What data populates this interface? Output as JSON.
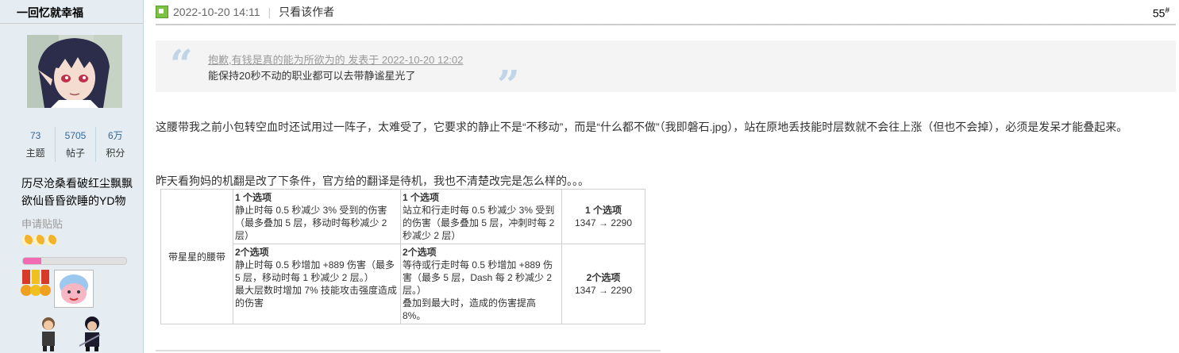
{
  "user": {
    "name": "一回忆就幸福",
    "stats": [
      {
        "value": "73",
        "label": "主题"
      },
      {
        "value": "5705",
        "label": "帖子"
      },
      {
        "value": "6万",
        "label": "积分"
      }
    ],
    "signature": [
      "历尽沧桑看破红尘飘飘",
      "欲仙昏昏欲睡的YD物"
    ],
    "apply_label": "申请贴贴",
    "level_progress": 0.18
  },
  "post": {
    "timestamp": "2022-10-20 14:11",
    "author_only": "只看该作者",
    "floor": "55",
    "floor_mark": "#",
    "quote": {
      "source": "抱歉,有钱是真的能为所欲为的 发表于 2022-10-20 12:02",
      "text": "能保持20秒不动的职业都可以去带静谧星光了"
    },
    "para1": "这腰带我之前小包转空血时还试用过一阵子，太难受了，它要求的静止不是“不移动”，而是“什么都不做”（我即磐石.jpg），站在原地丢技能时层数就不会往上涨（但也不会掉），必须是发呆才能叠起来。",
    "para2": "昨天看狗妈的机翻是改了下条件，官方给的翻译是待机，我也不清楚改完是怎么样的。。。",
    "table": {
      "item_name": "带星星的腰带",
      "row1": {
        "c1_title": "1 个选项",
        "c1_body": "静止时每 0.5 秒减少 3% 受到的伤害（最多叠加 5 层，移动时每秒减少 2 层）",
        "c2_title": "1 个选项",
        "c2_body": "站立和行走时每 0.5 秒减少 3% 受到的伤害（最多叠加 5 层，冲刺时每 2 秒减少 2 层）",
        "c3_title": "1 个选项",
        "c3_value": "1347 → 2290"
      },
      "row2": {
        "c1_title": "2个选项",
        "c1_body1": "静止时每 0.5 秒增加 +889 伤害（最多 5 层，移动时每 1 秒减少 2 层。）",
        "c1_body2": "最大层数时增加 7% 技能攻击强度造成的伤害",
        "c2_title": "2个选项",
        "c2_body1": "等待或行走时每 0.5 秒增加 +889 伤害（最多 5 层，Dash 每 2 秒减少 2 层。）",
        "c2_body2": "叠加到最大时，造成的伤害提高 8%。",
        "c3_title": "2个选项",
        "c3_value": "1347 → 2290"
      }
    }
  }
}
